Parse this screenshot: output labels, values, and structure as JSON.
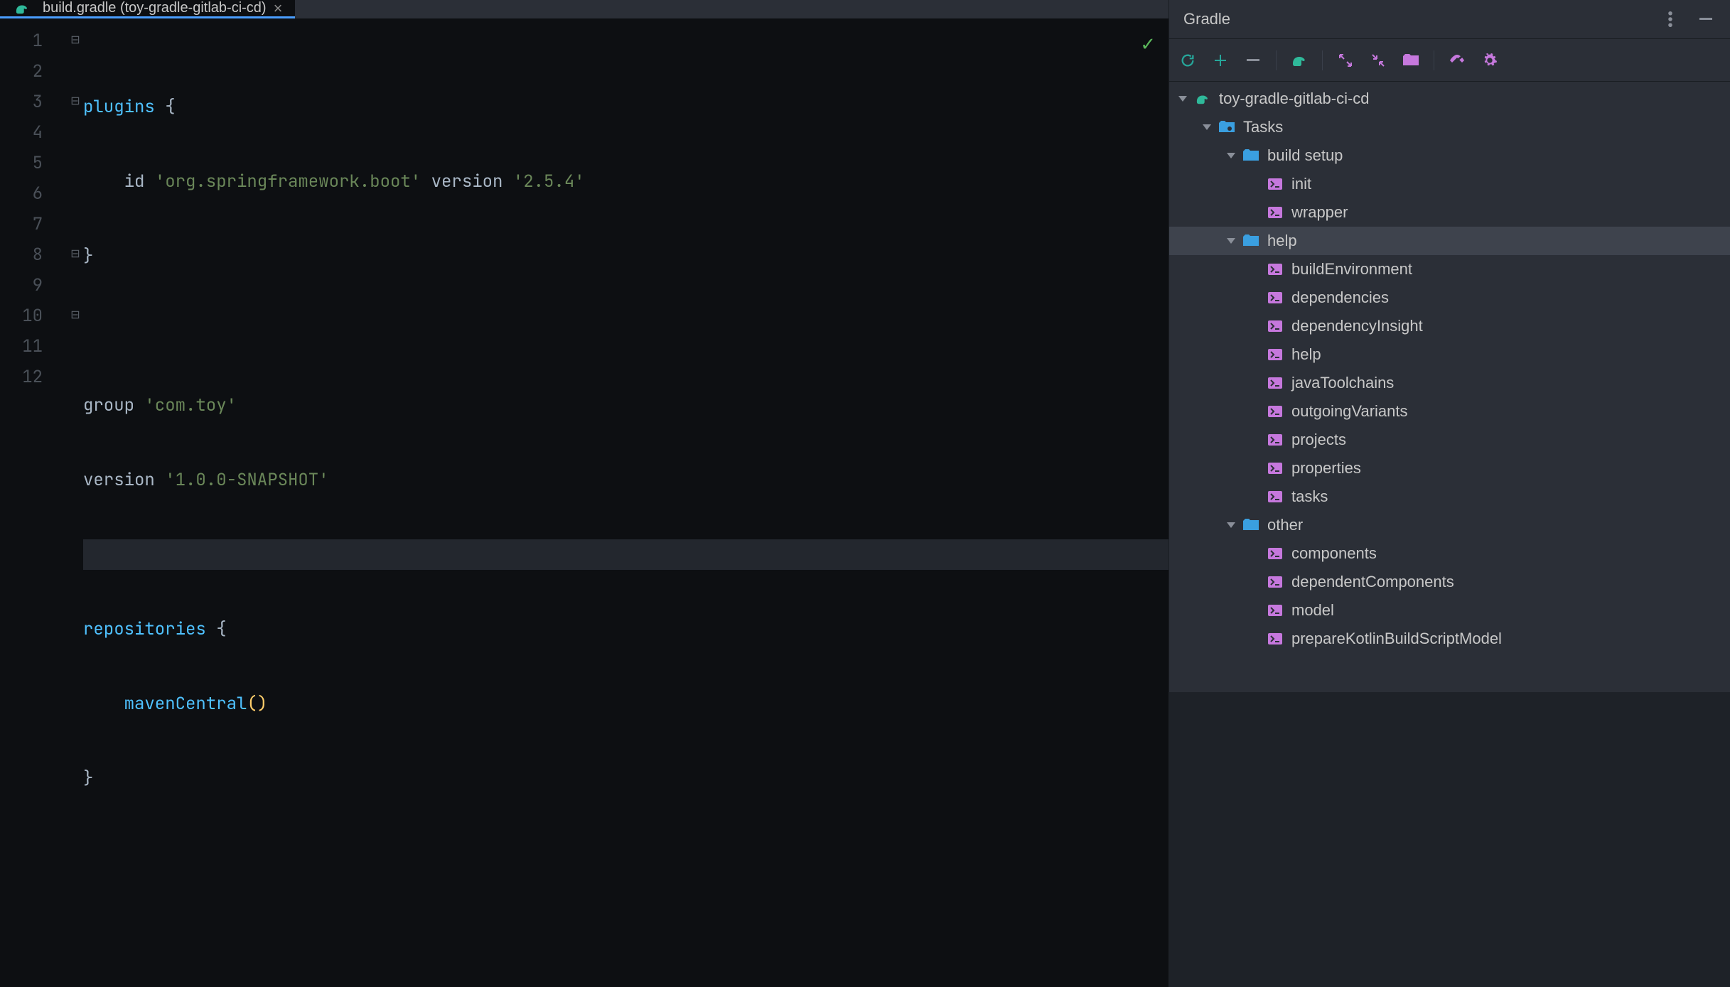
{
  "tab": {
    "title": "build.gradle (toy-gradle-gitlab-ci-cd)",
    "close": "×"
  },
  "editor": {
    "lines": [
      "1",
      "2",
      "3",
      "4",
      "5",
      "6",
      "7",
      "8",
      "9",
      "10",
      "11",
      "12"
    ],
    "current_line": 7,
    "code": {
      "l1_kw": "plugins ",
      "l1_brace": "{",
      "l2_indent": "    ",
      "l2_id": "id ",
      "l2_str1": "'org.springframework.boot' ",
      "l2_ver": "version ",
      "l2_str2": "'2.5.4'",
      "l3_brace": "}",
      "l5_kw": "group ",
      "l5_str": "'com.toy'",
      "l6_kw": "version ",
      "l6_str": "'1.0.0-SNAPSHOT'",
      "l8_kw": "repositories ",
      "l8_brace": "{",
      "l9_indent": "    ",
      "l9_fn": "mavenCentral",
      "l9_paren_o": "(",
      "l9_paren_c": ")",
      "l10_brace": "}"
    },
    "status": "✓"
  },
  "gradle": {
    "title": "Gradle",
    "project": "toy-gradle-gitlab-ci-cd",
    "groups": {
      "tasks": "Tasks",
      "build_setup": "build setup",
      "help": "help",
      "other": "other"
    },
    "tasks": {
      "init": "init",
      "wrapper": "wrapper",
      "buildEnvironment": "buildEnvironment",
      "dependencies": "dependencies",
      "dependencyInsight": "dependencyInsight",
      "help": "help",
      "javaToolchains": "javaToolchains",
      "outgoingVariants": "outgoingVariants",
      "projects": "projects",
      "properties": "properties",
      "tasks": "tasks",
      "components": "components",
      "dependentComponents": "dependentComponents",
      "model": "model",
      "prepareKotlinBuildScriptModel": "prepareKotlinBuildScriptModel"
    }
  }
}
